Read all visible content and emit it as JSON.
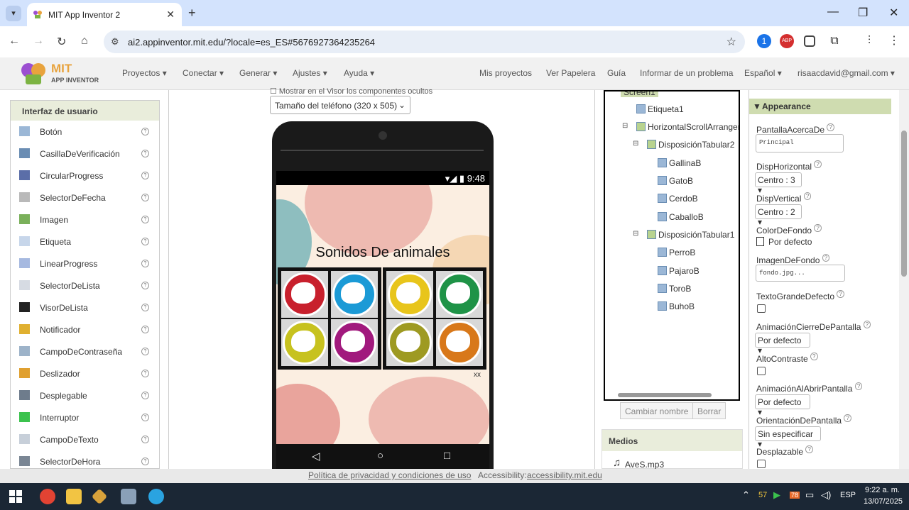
{
  "browser": {
    "tab_title": "MIT App Inventor 2",
    "url": "ai2.appinventor.mit.edu/?locale=es_ES#5676927364235264",
    "ext_badge": "1",
    "abp_label": "ABP"
  },
  "header": {
    "logo_mit": "MIT",
    "logo_sub": "APP INVENTOR",
    "menus": [
      "Proyectos",
      "Conectar",
      "Generar",
      "Ajustes",
      "Ayuda"
    ],
    "right_links": [
      "Mis proyectos",
      "Ver Papelera",
      "Guía",
      "Informar de un problema"
    ],
    "language": "Español",
    "user": "risaacdavid@gmail.com"
  },
  "palette": {
    "title": "Interfaz de usuario",
    "items": [
      "Botón",
      "CasillaDeVerificación",
      "CircularProgress",
      "SelectorDeFecha",
      "Imagen",
      "Etiqueta",
      "LinearProgress",
      "SelectorDeLista",
      "VisorDeLista",
      "Notificador",
      "CampoDeContraseña",
      "Deslizador",
      "Desplegable",
      "Interruptor",
      "CampoDeTexto",
      "SelectorDeHora"
    ],
    "help_glyph": "?"
  },
  "viewer": {
    "top_text": "Mostrar en el Visor los componentes ocultos",
    "size_select": "Tamaño del teléfono (320 x 505)",
    "status_time": "9:48",
    "app_title": "Sonidos De animales",
    "colors": [
      "#c8202d",
      "#1b9ad6",
      "#c7c21f",
      "#a1197d",
      "#e8c51b",
      "#1f9347",
      "#9e9a22",
      "#d8781a"
    ],
    "blob_colors": [
      "#e9a8a0",
      "#6aaeb3",
      "#f3cfa4",
      "#e38b84"
    ],
    "watermark": "xx"
  },
  "tree": {
    "root": "Screen1",
    "nodes": [
      "Etiqueta1",
      "HorizontalScrollArrangem",
      "DisposiciónTabular2",
      "GallinaB",
      "GatoB",
      "CerdoB",
      "CaballoB",
      "DisposiciónTabular1",
      "PerroB",
      "PajaroB",
      "ToroB",
      "BuhoB"
    ],
    "toggle": "⊟",
    "rename_button": "Cambiar nombre",
    "delete_button": "Borrar"
  },
  "media": {
    "title": "Medios",
    "file": "AveS.mp3"
  },
  "properties": {
    "section": "Appearance",
    "help_glyph": "?",
    "items": [
      {
        "label": "PantallaAcercaDe",
        "value": "Principal"
      },
      {
        "label": "DispHorizontal",
        "value": "Centro : 3 ▾"
      },
      {
        "label": "DispVertical",
        "value": "Centro : 2 ▾"
      },
      {
        "label": "ColorDeFondo",
        "value": "Por defecto"
      },
      {
        "label": "ImagenDeFondo",
        "value": "fondo.jpg..."
      },
      {
        "label": "TextoGrandeDefecto",
        "value": ""
      },
      {
        "label": "AnimaciónCierreDePantalla",
        "value": "Por defecto ▾"
      },
      {
        "label": "AltoContraste",
        "value": ""
      },
      {
        "label": "AnimaciónAlAbrirPantalla",
        "value": "Por defecto ▾"
      },
      {
        "label": "OrientaciónDePantalla",
        "value": "Sin especificar ▾"
      },
      {
        "label": "Desplazable",
        "value": ""
      }
    ]
  },
  "footer": {
    "privacy": "Política de privacidad y condiciones de uso",
    "accessibility_label": "Accessibility:",
    "accessibility_link": "accessibility.mit.edu"
  },
  "taskbar": {
    "temp": "57",
    "badge": "78",
    "lang": "ESP",
    "time": "9:22 a. m.",
    "date": "13/07/2025"
  }
}
